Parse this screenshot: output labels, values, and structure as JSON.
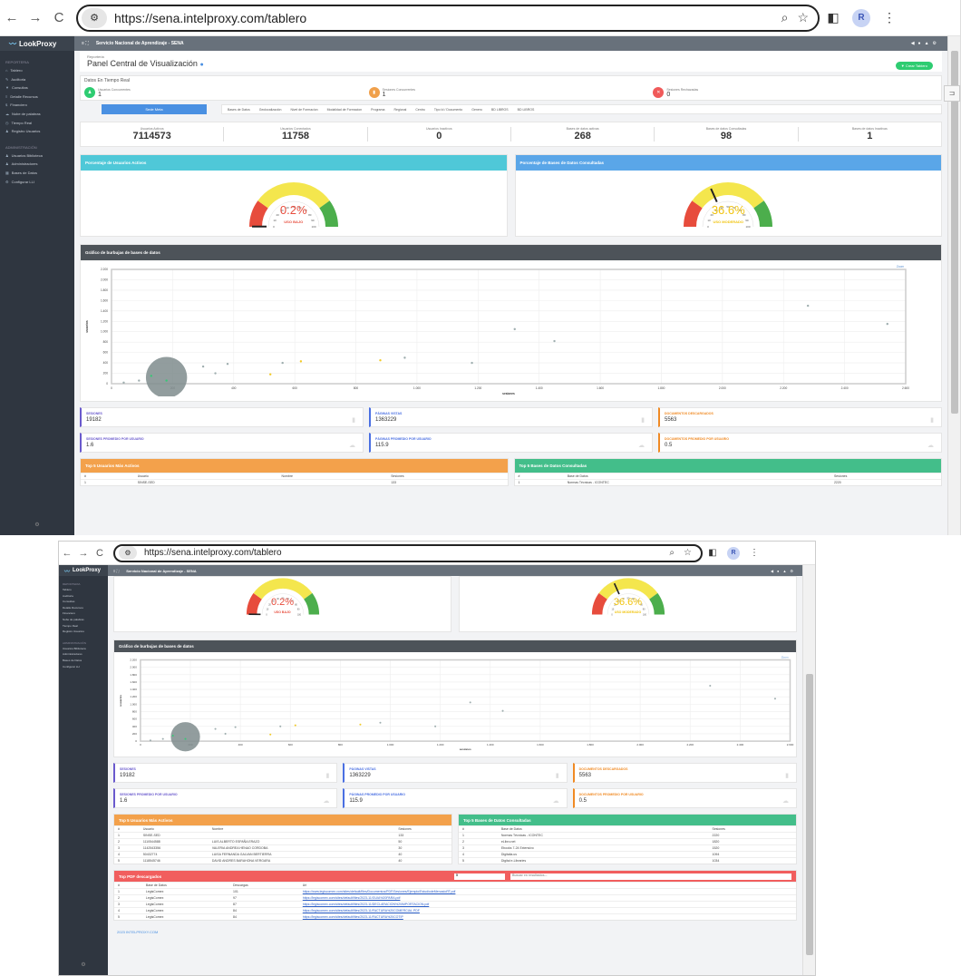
{
  "browser": {
    "url": "https://sena.intelproxy.com/tablero",
    "avatar": "R"
  },
  "app": {
    "brand": "LookProxy",
    "org_title": "Servicio Nacional de Aprendizaje - SENA",
    "sidebar": {
      "reportes_head": "REPORTERIA",
      "reportes": [
        "Tablero",
        "Auditoria",
        "Consultas",
        "Detalle Recursos",
        "Financiero",
        "Nube de palabras",
        "Tiempo Real",
        "Registro Usuarios"
      ],
      "admin_head": "ADMINISTRACIÓN",
      "admin": [
        "Usuarios Biblioteca",
        "Administradores",
        "Bases de Datos",
        "Configurar LLI"
      ]
    },
    "header": {
      "sub": "Reporteria",
      "title": "Panel Central de Visualización",
      "crear_btn": "Crear Tablero"
    },
    "realtime": {
      "title": "Datos En Tiempo Real",
      "items": [
        {
          "label": "Usuarios Concurrentes",
          "value": "1"
        },
        {
          "label": "Sesiones Concurrentes",
          "value": "1"
        },
        {
          "label": "Sesiones Rechazadas",
          "value": "0"
        }
      ]
    },
    "tabs": {
      "active": "Sede Meta",
      "others": [
        "Bases de Datos",
        "Geolocalización",
        "Nivel de Formacion",
        "Modalidad de Formacion",
        "Programa",
        "Regional",
        "Centro",
        "Tipo Id / Documento",
        "Genero",
        "BD LIBROS",
        "BD LIBROS"
      ]
    },
    "stats": [
      {
        "label": "Usuarios Activos",
        "value": "7114573"
      },
      {
        "label": "Usuarios Conectados",
        "value": "11758"
      },
      {
        "label": "Usuarios Inactivos",
        "value": "0"
      },
      {
        "label": "Bases de datos activas",
        "value": "268"
      },
      {
        "label": "Bases de datos Consultadas",
        "value": "98"
      },
      {
        "label": "Bases de datos Inactivas",
        "value": "1"
      }
    ],
    "gauge1": {
      "title": "Porcentaje de Usuarios Activos",
      "pct_text": "0.2%",
      "label": "USO BAJO",
      "value": 0.2,
      "pct_color": "#e74c3c"
    },
    "gauge2": {
      "title": "Porcentaje de Bases de Datos Consultadas",
      "pct_text": "36.6%",
      "label": "USO MODERADO",
      "value": 36.6,
      "pct_color": "#f1c40f"
    },
    "bubble": {
      "title": "Gráfico de burbujas de bases de datos",
      "xlabel": "sesiones",
      "ylabel": "usuarios",
      "zoom_label": "Zoom"
    },
    "kpis": [
      {
        "label": "SESIONES",
        "value": "19182",
        "color": "#6a5acd"
      },
      {
        "label": "PÁGINAS VISTAS",
        "value": "1363229",
        "color": "#4a6fe2"
      },
      {
        "label": "DOCUMENTOS DESCARGADOS",
        "value": "5563",
        "color": "#f08a24"
      },
      {
        "label": "SESIONES PROMEDIO POR USUARIO",
        "value": "1.6",
        "color": "#6a5acd"
      },
      {
        "label": "PÁGINAS PROMEDIO POR USUARIO",
        "value": "115.9",
        "color": "#4a6fe2"
      },
      {
        "label": "DOCUMENTOS PROMEDIO POR USUARIO",
        "value": "0.5",
        "color": "#f08a24"
      }
    ],
    "top_users": {
      "title": "Top 5 Usuarios Más Activos",
      "headers": [
        "#",
        "Usuario",
        "Nombre",
        "Sesiones"
      ],
      "rows": [
        [
          "1",
          "SINSE-SED",
          "",
          "133"
        ],
        [
          "2",
          "1110544588",
          "LUIS ALBERTO ESPAÑA ERAZO",
          "50"
        ],
        [
          "3",
          "1142543356",
          "VALERIA ANDREA HENAO CORDOBA",
          "30"
        ],
        [
          "4",
          "50432774",
          "LUISA FERNANDA GALVAN BERTIERRA",
          "40"
        ],
        [
          "5",
          "1118545746",
          "DAVID ANDRES BARAHONA VERGARA",
          "40"
        ]
      ]
    },
    "top_bases": {
      "title": "Top 5 Bases de Datos Consultadas",
      "headers": [
        "#",
        "Base de Datos",
        "",
        "Sesiones"
      ],
      "rows": [
        [
          "1",
          "Normas Técnicas - ICONTEC",
          "",
          "2220"
        ],
        [
          "2",
          "eLibro.net",
          "",
          "1820"
        ],
        [
          "3",
          "Ebooks 7-24 Extensivo",
          "",
          "1520"
        ],
        [
          "4",
          "Digitalia.us",
          "",
          "1094"
        ],
        [
          "5",
          "Digital e-Libraries",
          "",
          "1034"
        ]
      ]
    },
    "pdf": {
      "title": "Top PDF descargados",
      "select_value": "5",
      "search_placeholder": "Buscar en resultados...",
      "headers": [
        "#",
        "Base de Datos",
        "Descargas",
        "Url"
      ],
      "rows": [
        [
          "1",
          "LegisComex",
          "101",
          "https://www.legiscomex.com/sites/default/files/Documentos/PDF/Sesiones/Ejemplo/EstudiodeMercadoRT.pdf"
        ],
        [
          "2",
          "LegisComex",
          "97",
          "https://legiscomex.com/sites/default/files/2023-11/GUIA%20PARA.pdf"
        ],
        [
          "3",
          "LegisComex",
          "87",
          "https://legiscomex.com/sites/default/files/2023-11/DECLARACION%20IMPORTACION.pdf"
        ],
        [
          "4",
          "LegisComex",
          "84",
          "https://legiscomex.com/sites/default/files/2023-11/FACTURA%20COMERCIAL.PDF"
        ],
        [
          "5",
          "LegisComex",
          "84",
          "https://legiscomex.com/sites/default/files/2023-11/FACTURA%20COTIP"
        ]
      ]
    },
    "footer": "2023 INTELPROXY.COM"
  },
  "chart_data": {
    "type": "scatter",
    "title": "Gráfico de burbujas de bases de datos",
    "xlabel": "sesiones",
    "ylabel": "usuarios",
    "xlim": [
      0,
      2600
    ],
    "ylim": [
      0,
      2200
    ],
    "x_ticks": [
      "0",
      "200",
      "400",
      "600",
      "800",
      "1.000",
      "1.200",
      "1.400",
      "1.600",
      "1.800",
      "2.000",
      "2.200",
      "2.400",
      "2.600"
    ],
    "y_ticks": [
      "0",
      "200",
      "400",
      "600",
      "800",
      "1.000",
      "1.200",
      "1.400",
      "1.600",
      "1.800",
      "2.000",
      "2.200"
    ],
    "points": [
      {
        "x": 180,
        "y": 120,
        "r": 90,
        "color": "#7f8c8d"
      },
      {
        "x": 180,
        "y": 60,
        "r": 6,
        "color": "#2ecc71"
      },
      {
        "x": 40,
        "y": 20,
        "r": 3,
        "color": "#95a5a6"
      },
      {
        "x": 90,
        "y": 60,
        "r": 3,
        "color": "#95a5a6"
      },
      {
        "x": 130,
        "y": 150,
        "r": 3,
        "color": "#2ecc71"
      },
      {
        "x": 300,
        "y": 330,
        "r": 3,
        "color": "#95a5a6"
      },
      {
        "x": 380,
        "y": 380,
        "r": 3,
        "color": "#95a5a6"
      },
      {
        "x": 340,
        "y": 200,
        "r": 3,
        "color": "#95a5a6"
      },
      {
        "x": 520,
        "y": 180,
        "r": 3,
        "color": "#f1c40f"
      },
      {
        "x": 560,
        "y": 400,
        "r": 3,
        "color": "#95a5a6"
      },
      {
        "x": 620,
        "y": 430,
        "r": 3,
        "color": "#f1c40f"
      },
      {
        "x": 880,
        "y": 450,
        "r": 3,
        "color": "#f1c40f"
      },
      {
        "x": 960,
        "y": 500,
        "r": 3,
        "color": "#95a5a6"
      },
      {
        "x": 1180,
        "y": 400,
        "r": 3,
        "color": "#95a5a6"
      },
      {
        "x": 1320,
        "y": 1050,
        "r": 3,
        "color": "#95a5a6"
      },
      {
        "x": 1450,
        "y": 820,
        "r": 3,
        "color": "#95a5a6"
      },
      {
        "x": 2280,
        "y": 1500,
        "r": 3,
        "color": "#95a5a6"
      },
      {
        "x": 2540,
        "y": 1150,
        "r": 3,
        "color": "#95a5a6"
      }
    ]
  }
}
